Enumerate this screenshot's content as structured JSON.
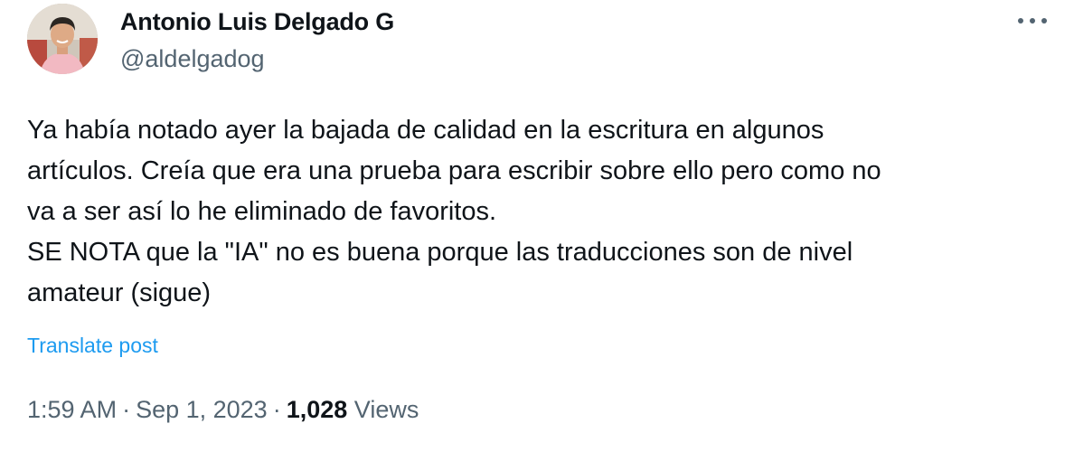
{
  "author": {
    "display_name": "Antonio Luis Delgado G",
    "handle": "@aldelgadog"
  },
  "more_menu_icon": "more-horizontal-icon",
  "tweet": {
    "lines": [
      "Ya había notado ayer la bajada de calidad en la escritura en algunos",
      "artículos. Creía que era una prueba para escribir sobre ello pero como no",
      "va a ser así lo he eliminado de favoritos.",
      "SE NOTA que la \"IA\" no es buena porque las traducciones son de nivel",
      "amateur (sigue)"
    ],
    "translate_label": "Translate post"
  },
  "meta": {
    "time": "1:59 AM",
    "separator": "·",
    "date": "Sep 1, 2023",
    "views_count": "1,028",
    "views_label": "Views"
  },
  "colors": {
    "text_primary": "#0f1419",
    "text_secondary": "#536471",
    "link": "#1d9bf0"
  }
}
